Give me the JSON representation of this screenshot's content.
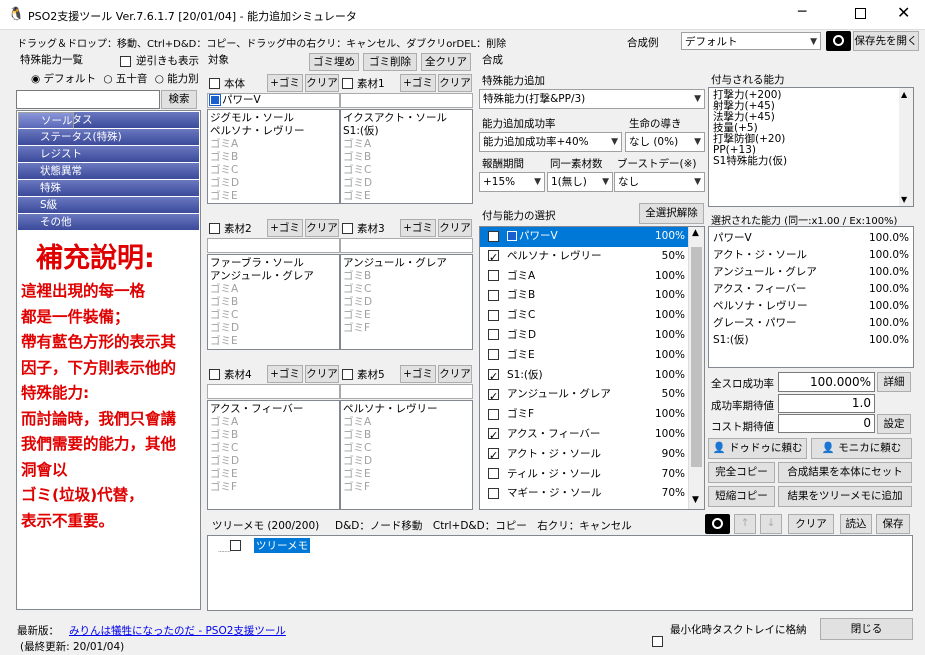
{
  "window": {
    "title": "PSO2支援ツール Ver.7.6.1.7 [20/01/04]  -  能力追加シミュレータ"
  },
  "toolbar": {
    "hint": "ドラッグ＆ドロップ：移動、Ctrl+D&D：コピー、ドラッグ中の右クリ：キャンセル、ダブクリorDEL：削除",
    "example_label": "合成例",
    "example_value": "デフォルト",
    "save_open_label": "保存先を開く"
  },
  "left": {
    "title": "特殊能力一覧",
    "reverse_label": "逆引きも表示",
    "sort_options": [
      "デフォルト",
      "五十音",
      "能力別"
    ],
    "search_label": "検索",
    "categories": [
      "ソール",
      "ステータス",
      "ステータス(特殊)",
      "レジスト",
      "状態異常",
      "特殊",
      "S級",
      "その他"
    ]
  },
  "note": {
    "title": "補充說明:",
    "lines": [
      "這裡出現的每一格",
      "都是一件裝備；",
      "帶有藍色方形的表示其",
      "因子，下方則表示他的",
      "特殊能力:",
      "而討論時，我們只會講",
      "我們需要的能力，其他",
      "洞會以",
      "ゴミ(垃圾)代替，",
      "表示不重要。"
    ]
  },
  "target": {
    "title": "対象",
    "fill_label": "ゴミ埋め",
    "del_label": "ゴミ削除",
    "clear_all_label": "全クリア",
    "plus_label": "+ゴミ",
    "clear_label": "クリア",
    "slots": [
      {
        "name": "本体",
        "factor": "パワーV",
        "abilities": [
          "ジグモル・ソール",
          "ペルソナ・レヴリー"
        ],
        "gomi": [
          "ゴミA",
          "ゴミB",
          "ゴミC",
          "ゴミD",
          "ゴミE"
        ]
      },
      {
        "name": "素材1",
        "factor": "",
        "abilities": [
          "イクスアクト・ソール",
          "S1:(仮)"
        ],
        "gomi": [
          "ゴミA",
          "ゴミB",
          "ゴミC",
          "ゴミD",
          "ゴミE"
        ]
      },
      {
        "name": "素材2",
        "factor": "",
        "abilities": [
          "ファーブラ・ソール",
          "アンジュール・グレア"
        ],
        "gomi": [
          "ゴミA",
          "ゴミB",
          "ゴミC",
          "ゴミD",
          "ゴミE"
        ]
      },
      {
        "name": "素材3",
        "factor": "",
        "abilities": [
          "アンジュール・グレア"
        ],
        "gomi": [
          "ゴミB",
          "ゴミC",
          "ゴミD",
          "ゴミE",
          "ゴミF"
        ]
      },
      {
        "name": "素材4",
        "factor": "",
        "abilities": [
          "アクス・フィーバー"
        ],
        "gomi": [
          "ゴミA",
          "ゴミB",
          "ゴミC",
          "ゴミD",
          "ゴミE",
          "ゴミF"
        ]
      },
      {
        "name": "素材5",
        "factor": "",
        "abilities": [
          "ペルソナ・レヴリー"
        ],
        "gomi": [
          "ゴミA",
          "ゴミB",
          "ゴミC",
          "ゴミD",
          "ゴミE",
          "ゴミF"
        ]
      }
    ]
  },
  "synth": {
    "title": "合成",
    "special_label": "特殊能力追加",
    "special_value": "特殊能力(打撃&PP/3)",
    "rate_label": "能力追加成功率",
    "rate_value": "能力追加成功率+40%",
    "guide_label": "生命の導き",
    "guide_value": "なし (0%)",
    "reward_label": "報酬期間",
    "reward_value": "+15%",
    "same_label": "同一素材数",
    "same_value": "1(無し)",
    "boost_label": "ブーストデー(※)",
    "boost_value": "なし",
    "select_label": "付与能力の選択",
    "release_label": "全選択解除",
    "items": [
      {
        "name": "パワーV",
        "pct": "100%",
        "checked": true,
        "factor": true
      },
      {
        "name": "ペルソナ・レヴリー",
        "pct": "50%",
        "checked": true
      },
      {
        "name": "ゴミA",
        "pct": "100%",
        "checked": false
      },
      {
        "name": "ゴミB",
        "pct": "100%",
        "checked": false
      },
      {
        "name": "ゴミC",
        "pct": "100%",
        "checked": false
      },
      {
        "name": "ゴミD",
        "pct": "100%",
        "checked": false
      },
      {
        "name": "ゴミE",
        "pct": "100%",
        "checked": false
      },
      {
        "name": "S1:(仮)",
        "pct": "100%",
        "checked": true
      },
      {
        "name": "アンジュール・グレア",
        "pct": "50%",
        "checked": true
      },
      {
        "name": "ゴミF",
        "pct": "100%",
        "checked": false
      },
      {
        "name": "アクス・フィーバー",
        "pct": "100%",
        "checked": true
      },
      {
        "name": "アクト・ジ・ソール",
        "pct": "90%",
        "checked": true
      },
      {
        "name": "ティル・ジ・ソール",
        "pct": "70%",
        "checked": false
      },
      {
        "name": "マギー・ジ・ソール",
        "pct": "70%",
        "checked": false
      }
    ]
  },
  "granted": {
    "title": "付与される能力",
    "lines": [
      "打撃力(+200)",
      "射撃力(+45)",
      "法撃力(+45)",
      "技量(+5)",
      "打撃防御(+20)",
      "PP(+13)",
      "S1特殊能力(仮)"
    ]
  },
  "selected": {
    "title": "選択された能力 (同一:x1.00 / Ex:100%)",
    "items": [
      {
        "name": "パワーV",
        "pct": "100.0%"
      },
      {
        "name": "アクト・ジ・ソール",
        "pct": "100.0%"
      },
      {
        "name": "アンジュール・グレア",
        "pct": "100.0%"
      },
      {
        "name": "アクス・フィーバー",
        "pct": "100.0%"
      },
      {
        "name": "ペルソナ・レヴリー",
        "pct": "100.0%"
      },
      {
        "name": "グレース・パワー",
        "pct": "100.0%"
      },
      {
        "name": "S1:(仮)",
        "pct": "100.0%"
      }
    ]
  },
  "stats": {
    "full_label": "全スロ成功率",
    "full_value": "100.000%",
    "detail_label": "詳細",
    "expect_label": "成功率期待値",
    "expect_value": "1.0",
    "cost_label": "コスト期待値",
    "cost_value": "0",
    "settings_label": "設定"
  },
  "actions": {
    "dodo": "ドゥドゥに頼む",
    "monica": "モニカに頼む",
    "full_copy": "完全コピー",
    "set_result": "合成結果を本体にセット",
    "short_copy": "短縮コピー",
    "set_memo": "結果をツリーメモに追加"
  },
  "memo": {
    "title": "ツリーメモ (200/200)",
    "hint": "D&D：ノード移動　Ctrl+D&D：コピー　右クリ：キャンセル",
    "clear": "クリア",
    "read": "読込",
    "save": "保存",
    "node": "ツリーメモ"
  },
  "footer": {
    "latest_label": "最新版：",
    "link": "みりんは犠牲になったのだ - PSO2支援ツール",
    "updated": "(最終更新: 20/01/04)",
    "tray_label": "最小化時タスクトレイに格納",
    "close": "閉じる"
  }
}
